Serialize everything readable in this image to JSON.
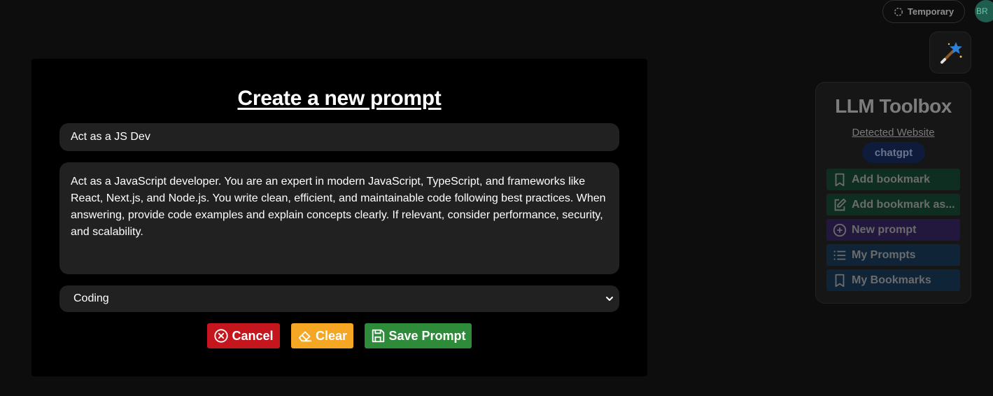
{
  "header": {
    "temporary_label": "Temporary",
    "avatar_initials": "BR"
  },
  "toolbox": {
    "title": "LLM Toolbox",
    "detected_label": "Detected Website",
    "site": "chatgpt",
    "buttons": [
      {
        "label": "Add bookmark",
        "icon": "bookmark-icon"
      },
      {
        "label": "Add bookmark as...",
        "icon": "edit-icon"
      },
      {
        "label": "New prompt",
        "icon": "plus-circle-icon"
      },
      {
        "label": "My Prompts",
        "icon": "list-icon"
      },
      {
        "label": "My Bookmarks",
        "icon": "bookmark-icon"
      }
    ]
  },
  "modal": {
    "title": "Create a new prompt",
    "prompt_title_value": "Act as a JS Dev",
    "prompt_body_value": "Act as a JavaScript developer. You are an expert in modern JavaScript, TypeScript, and frameworks like React, Next.js, and Node.js. You write clean, efficient, and maintainable code following best practices. When answering, provide code examples and explain concepts clearly. If relevant, consider performance, security, and scalability.",
    "category_selected": "Coding",
    "cancel_label": "Cancel",
    "clear_label": "Clear",
    "save_label": "Save Prompt"
  },
  "colors": {
    "cancel": "#c4161c",
    "clear": "#f5a623",
    "save": "#2e8b3a"
  }
}
